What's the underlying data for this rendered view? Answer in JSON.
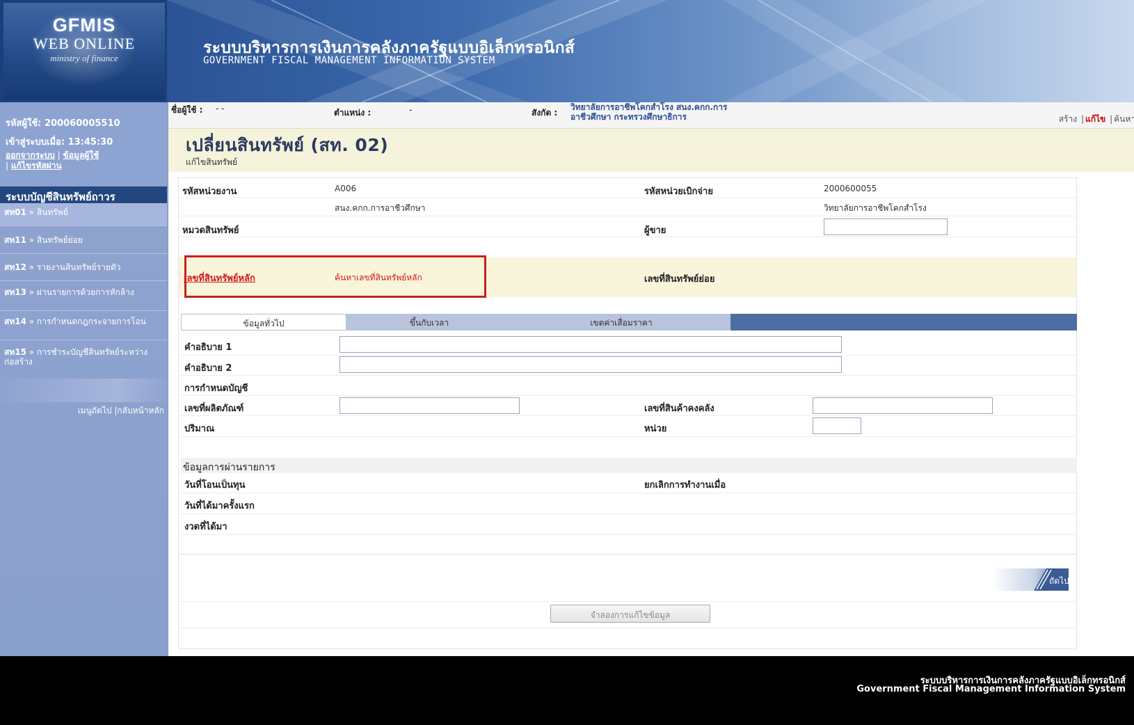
{
  "header": {
    "logo_top": "GFMIS",
    "logo_mid": "WEB ONLINE",
    "logo_sub": "ministry of finance",
    "system_name_th": "ระบบบริหารการเงินการคลังภาครัฐแบบอิเล็กทรอนิกส์",
    "system_name_en": "GOVERNMENT FISCAL MANAGEMENT INFORMATION SYSTEM"
  },
  "sidebar": {
    "user_code_label": "รหัสผู้ใช้:",
    "user_code": "200060005510",
    "login_label": "เข้าสู่ระบบเมื่อ:",
    "login_time": "13:45:30",
    "logout": "ออกจากระบบ",
    "user_info": "ข้อมูลผู้ใช้",
    "change_password": "แก้ไขรหัสผ่าน",
    "menu_title": "ระบบบัญชีสินทรัพย์ถาวร",
    "menu": [
      {
        "code": "สท01",
        "label": "สินทรัพย์"
      },
      {
        "code": "สท11",
        "label": "สินทรัพย์ย่อย"
      },
      {
        "code": "สท12",
        "label": "รายงานสินทรัพย์รายตัว"
      },
      {
        "code": "สท13",
        "label": "ผ่านรายการด้วยการหักล้าง"
      },
      {
        "code": "สท14",
        "label": "การกำหนดกฎกระจายการโอน"
      },
      {
        "code": "สท15",
        "label": "การชำระบัญชีสินทรัพย์ระหว่างก่อสร้าง"
      }
    ],
    "nav_next": "เมนูถัดไป",
    "nav_home": "กลับหน้าหลัก"
  },
  "info_bar": {
    "user_label": "ชื่อผู้ใช้ :",
    "user_value": "- -",
    "position_label": "ตำแหน่ง :",
    "position_value": "-",
    "org_label": "สังกัด :",
    "org_line1": "วิทยาลัยการอาชีพโคกสำโรง สนง.คกก.การ",
    "org_line2": "อาชีวศึกษา กระทรวงศึกษาธิการ",
    "actions": [
      "สร้าง",
      "แก้ไข",
      "ค้นหา"
    ]
  },
  "page": {
    "title": "เปลี่ยนสินทรัพย์ (สท. 02)",
    "subtitle": "แก้ไขสินทรัพย์"
  },
  "form": {
    "unit_code_label": "รหัสหน่วยงาน",
    "unit_code": "A006",
    "unit_name": "สนง.คกก.การอาชีวศึกษา",
    "disb_unit_label": "รหัสหน่วยเบิกจ่าย",
    "disb_unit_code": "2000600055",
    "disb_unit_name": "วิทยาลัยการอาชีพโคกสำโรง",
    "asset_category_label": "หมวดสินทรัพย์",
    "seller_label": "ผู้ขาย",
    "main_asset_label": "เลขที่สินทรัพย์หลัก",
    "search_main_asset": "ค้นหาเลขที่สินทรัพย์หลัก",
    "sub_asset_label": "เลขที่สินทรัพย์ย่อย",
    "tabs": [
      "ข้อมูลทั่วไป",
      "ขึ้นกับเวลา",
      "เขตค่าเสื่อมราคา"
    ],
    "desc1_label": "คำอธิบาย 1",
    "desc2_label": "คำอธิบาย 2",
    "account_label": "การกำหนดบัญชี",
    "product_no_label": "เลขที่ผลิตภัณฑ์",
    "inventory_no_label": "เลขที่สินค้าคงคลัง",
    "quantity_label": "ปริมาณ",
    "unit_label": "หน่วย",
    "posting_section": "ข้อมูลการผ่านรายการ",
    "capitalize_date_label": "วันที่โอนเป็นทุน",
    "deactivate_label": "ยกเลิกการทำงานเมื่อ",
    "first_acq_label": "วันที่ได้มาครั้งแรก",
    "acq_period_label": "งวดที่ได้มา",
    "next_button": "ถัดไป »",
    "simulate_button": "จำลองการแก้ไขข้อมูล"
  },
  "footer": {
    "line_th": "ระบบบริหารการเงินการคลังภาครัฐแบบอิเล็กทรอนิกส์",
    "line_en": "Government Fiscal Management Information System"
  }
}
